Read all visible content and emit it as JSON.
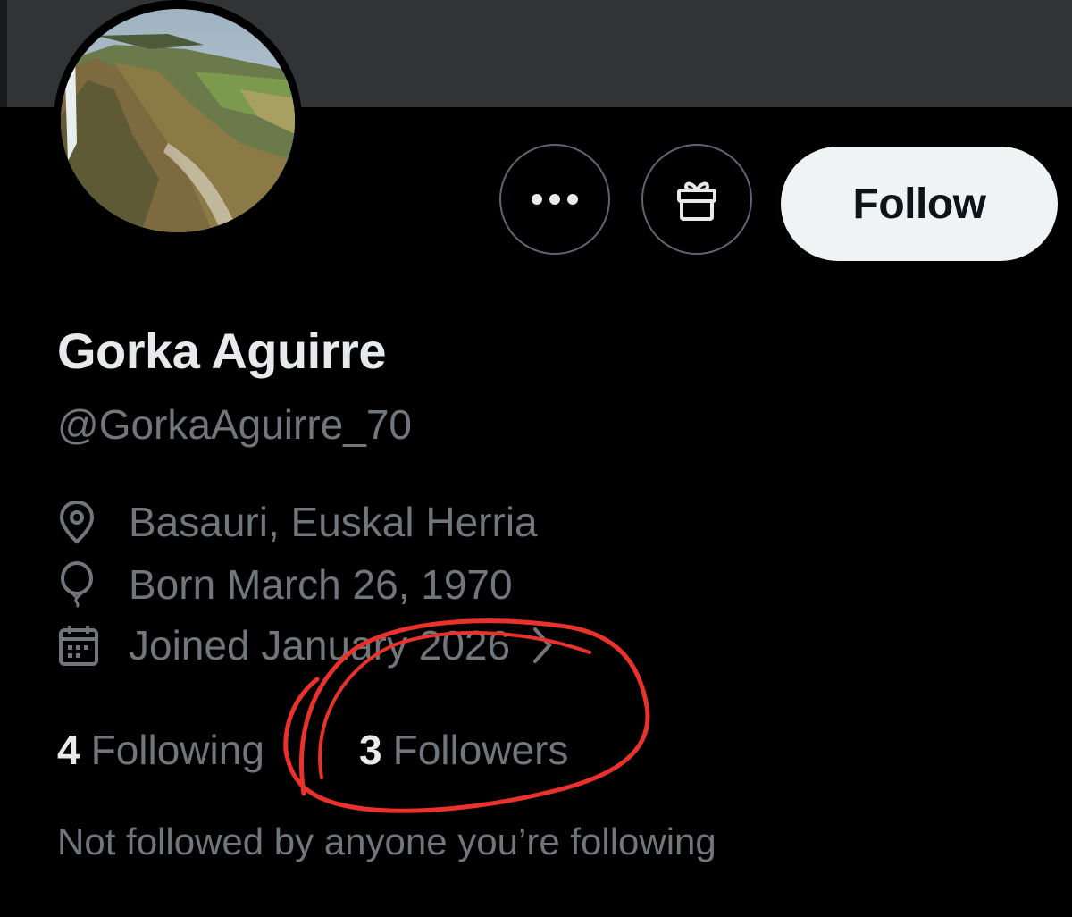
{
  "profile": {
    "display_name": "Gorka Aguirre",
    "handle": "@GorkaAguirre_70",
    "location": "Basauri, Euskal Herria",
    "birth": "Born March 26, 1970",
    "joined": "Joined January 2026"
  },
  "actions": {
    "follow_label": "Follow",
    "more_icon": "more-dots-icon",
    "gift_icon": "gift-icon"
  },
  "stats": {
    "following_count": "4",
    "following_label": "Following",
    "followers_count": "3",
    "followers_label": "Followers"
  },
  "social_context": "Not followed by anyone you’re following",
  "colors": {
    "background": "#000000",
    "banner": "#323335",
    "primary_text": "#e7e9ea",
    "secondary_text": "#71767b",
    "follow_button_bg": "#eff3f4",
    "annotation": "#e8322b"
  },
  "icons": [
    "location-pin-icon",
    "balloon-icon",
    "calendar-icon",
    "chevron-right-icon"
  ]
}
